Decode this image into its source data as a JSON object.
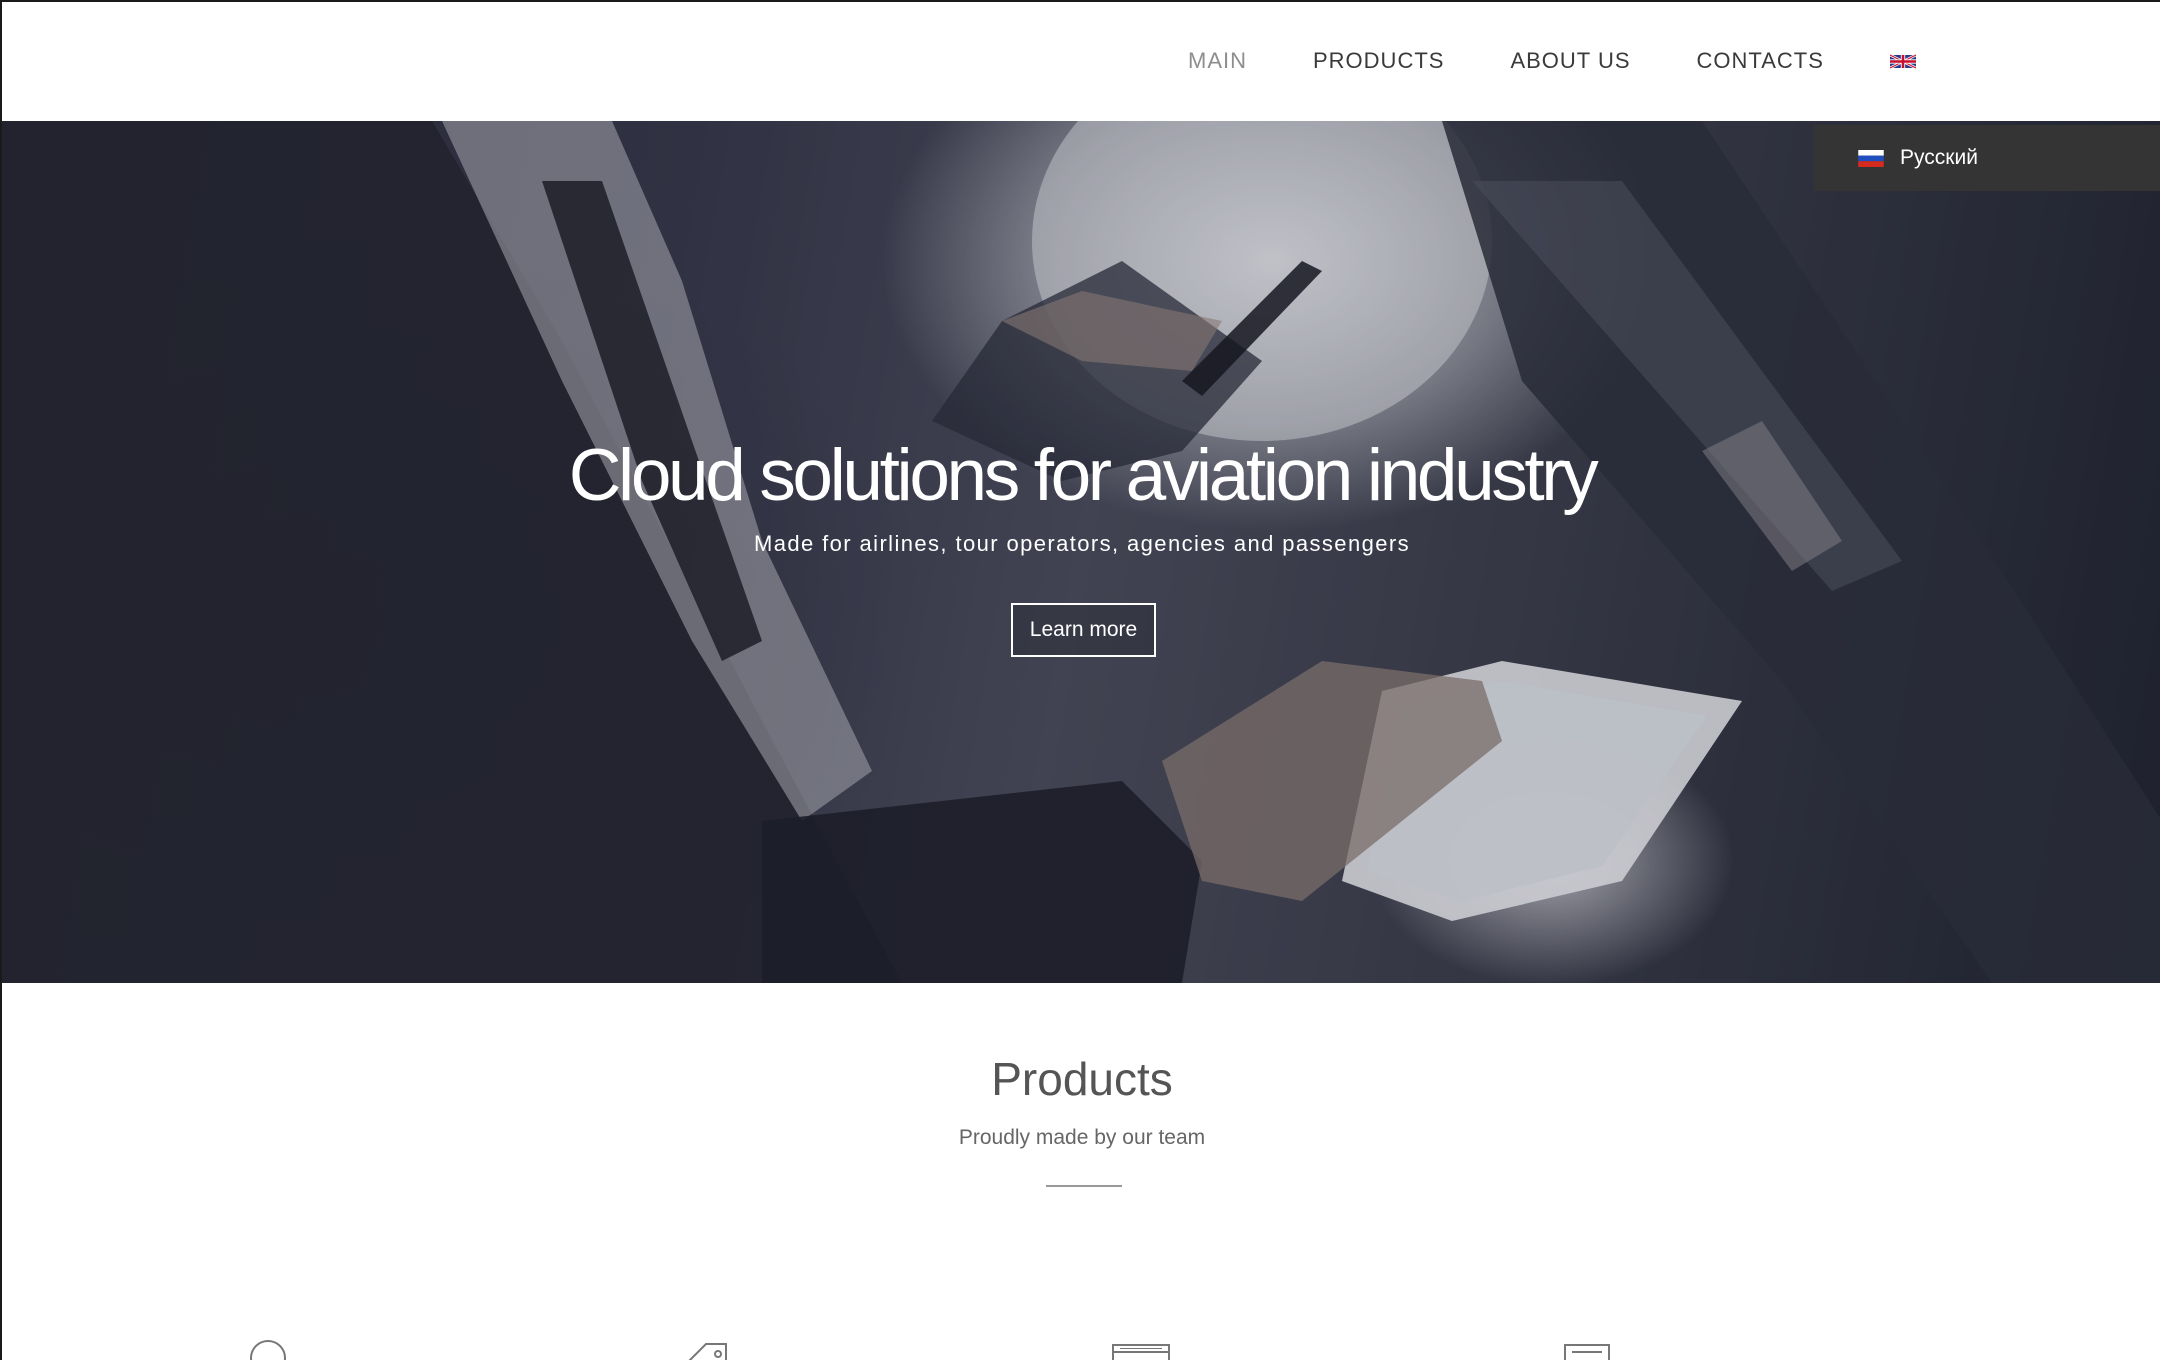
{
  "header": {
    "nav": [
      {
        "label": "MAIN",
        "active": true
      },
      {
        "label": "PRODUCTS",
        "active": false
      },
      {
        "label": "ABOUT US",
        "active": false
      },
      {
        "label": "CONTACTS",
        "active": false
      }
    ],
    "language_icon": "uk-flag-icon"
  },
  "language_menu": {
    "option_label": "Русский",
    "option_icon": "russia-flag-icon"
  },
  "hero": {
    "title": "Cloud solutions for aviation industry",
    "subtitle": "Made for airlines, tour operators, agencies and passengers",
    "cta_label": "Learn more"
  },
  "products": {
    "title": "Products",
    "subtitle": "Proudly made by our team",
    "icons": [
      "clock-icon",
      "tag-icon",
      "browser-window-icon",
      "document-icon"
    ]
  },
  "colors": {
    "nav_text": "#3a3a3a",
    "nav_active": "#8e8e8e",
    "dropdown_bg": "#343434",
    "heading": "#555555"
  }
}
